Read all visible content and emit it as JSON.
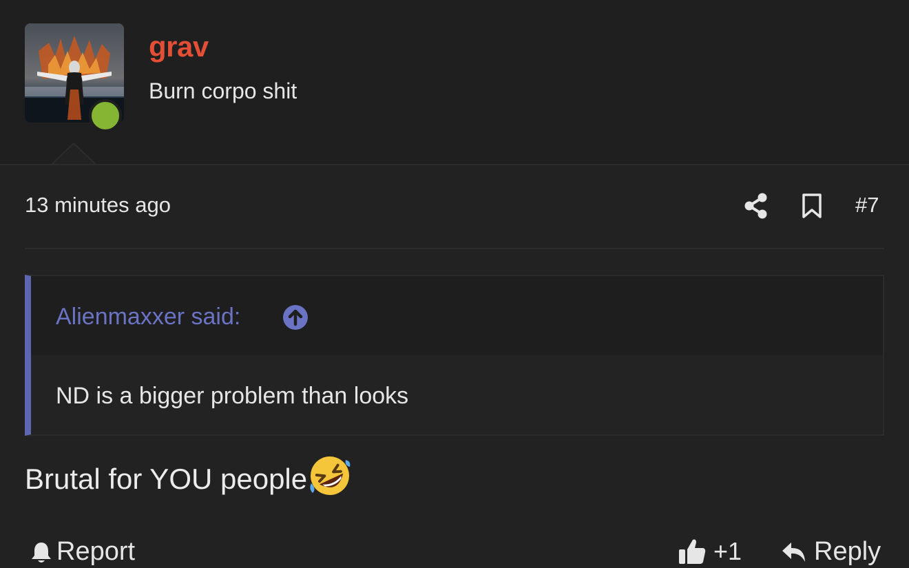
{
  "user": {
    "name": "grav",
    "title": "Burn corpo shit",
    "online": true
  },
  "post": {
    "time": "13 minutes ago",
    "number": "#7"
  },
  "quote": {
    "author": "Alienmaxxer said:",
    "text": "ND is a bigger problem than looks"
  },
  "message": {
    "text": "Brutal for YOU people",
    "emoji": "rolling-on-floor-laughing"
  },
  "actions": {
    "report": "Report",
    "like_count": "+1",
    "reply": "Reply"
  },
  "colors": {
    "background": "#222222",
    "username": "#e24e36",
    "quote_accent": "#5c66b3",
    "online": "#84b634"
  }
}
